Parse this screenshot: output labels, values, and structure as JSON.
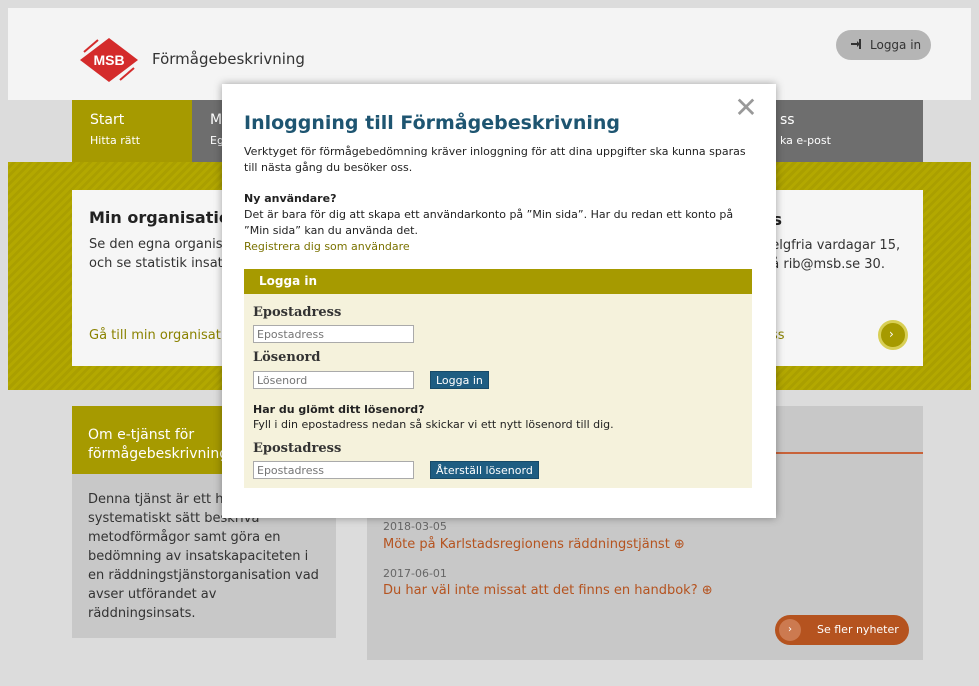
{
  "header": {
    "logo_text": "MSB",
    "site_title": "Förmågebeskrivning",
    "login_button": "Logga in"
  },
  "nav": {
    "tabs": [
      {
        "title": "Start",
        "subtitle": "Hitta rätt"
      },
      {
        "title": "M",
        "subtitle": "Eg"
      },
      {
        "title": "ss",
        "subtitle": "ka e-post"
      }
    ]
  },
  "cards": {
    "left": {
      "title": "Min organisatio",
      "text": "Se den egna organisa förmågor kopplade ti risker och se statistik insatser.",
      "link": "Gå till min organisati"
    },
    "right": {
      "title": "ss",
      "text": "helgfria vardagar 15, på rib@msb.se 30.",
      "link": "oss"
    }
  },
  "info": {
    "heading": "Om e-tjänst för förmågebeskrivning",
    "body": "Denna tjänst är ett h att på ett systematiskt sätt beskriva metodförmågor samt göra en bedömning av insatskapaciteten i en räddningstjänstorganisation vad avser utförandet av räddningsinsats."
  },
  "news": {
    "items": [
      {
        "date": "2018-03-05",
        "title": "Möte på Karlstadsregionens räddningstjänst ⊕"
      },
      {
        "date": "2017-06-01",
        "title": "Du har väl inte missat att det finns en handbok? ⊕"
      }
    ],
    "more_button": "Se fler nyheter"
  },
  "modal": {
    "title": "Inloggning till Förmågebeskrivning",
    "intro": "Verktyget för förmågebedömning kräver inloggning för att dina uppgifter ska kunna sparas till nästa gång du besöker oss.",
    "new_user_heading": "Ny användare?",
    "new_user_text": "Det är bara för dig att skapa ett användarkonto på ”Min sida”. Har du redan ett konto på ”Min sida” kan du använda det.",
    "register_link": "Registrera dig som användare",
    "login_panel": {
      "header": "Logga in",
      "email_label": "Epostadress",
      "email_placeholder": "Epostadress",
      "password_label": "Lösenord",
      "password_placeholder": "Lösenord",
      "login_button": "Logga in",
      "forgot_heading": "Har du glömt ditt lösenord?",
      "forgot_text": "Fyll i din epostadress nedan så skickar vi ett nytt lösenord till dig.",
      "reset_email_label": "Epostadress",
      "reset_email_placeholder": "Epostadress",
      "reset_button": "Återställ lösenord"
    },
    "close_symbol": "✕"
  },
  "colors": {
    "brand_olive": "#a69a00",
    "title_blue": "#1e5571",
    "button_blue": "#1e5d82",
    "news_orange": "#b5531f",
    "logo_red": "#d42b2b"
  }
}
